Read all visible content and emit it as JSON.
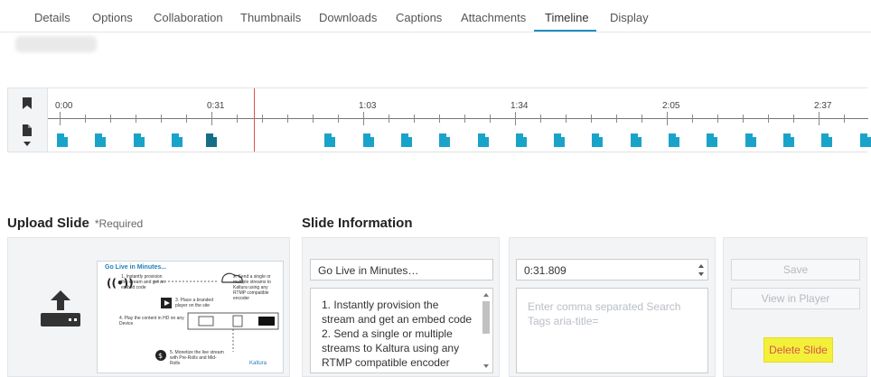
{
  "tabs": [
    {
      "label": "Details",
      "active": false
    },
    {
      "label": "Options",
      "active": false
    },
    {
      "label": "Collaboration",
      "active": false
    },
    {
      "label": "Thumbnails",
      "active": false
    },
    {
      "label": "Downloads",
      "active": false
    },
    {
      "label": "Captions",
      "active": false
    },
    {
      "label": "Attachments",
      "active": false
    },
    {
      "label": "Timeline",
      "active": true
    },
    {
      "label": "Display",
      "active": false
    }
  ],
  "timeline": {
    "time_labels": [
      "0:00",
      "0:31",
      "1:03",
      "1:34",
      "2:05",
      "2:37"
    ],
    "slide_marker_count": 20,
    "selected_marker_index": 4,
    "colors": {
      "marker": "#1aa3c9",
      "marker_selected": "#146f86",
      "playhead": "#d9534f"
    }
  },
  "upload": {
    "heading": "Upload Slide",
    "required_note": "*Required",
    "thumbnail": {
      "title": "Go Live in Minutes...",
      "step1": "1. Instantly provision the stream and get an embed code",
      "step2": "2. Send a single or multiple streams to Kaltura using any RTMP compatible encoder",
      "step3": "3. Place a branded player on the site",
      "step4": "4. Play the content in HD on any Device",
      "step5": "5. Monetize the live stream with Pre-Rolls and Mid-Rolls",
      "brand": "Kaltura"
    }
  },
  "slide_info": {
    "heading": "Slide Information",
    "title_value": "Go Live in Minutes…",
    "description_value": "1. Instantly provision the stream and get an embed code\n2. Send a single or multiple streams to Kaltura using any RTMP compatible encoder",
    "time_value": "0:31.809",
    "tags_placeholder": "Enter comma separated Search Tags aria-title="
  },
  "actions": {
    "save_label": "Save",
    "view_label": "View in Player",
    "delete_label": "Delete Slide",
    "delete_color": "#f3f03a"
  }
}
